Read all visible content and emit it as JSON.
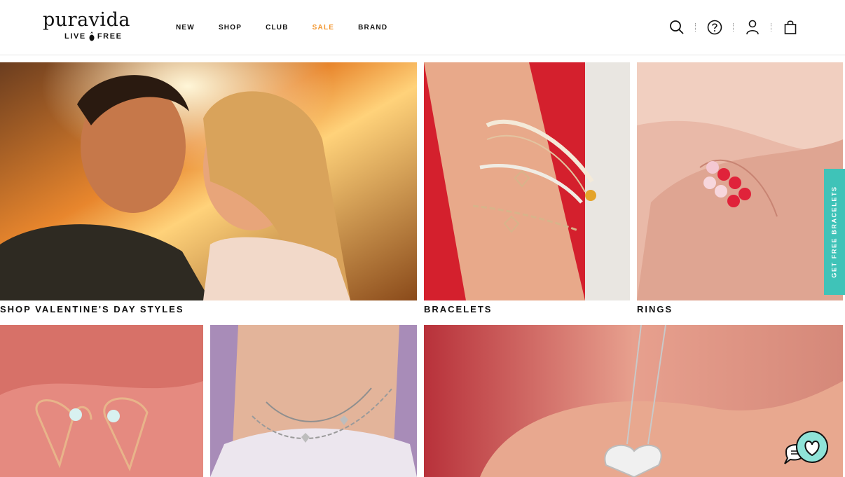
{
  "brand": {
    "name": "puravida",
    "tagline_left": "LIVE",
    "tagline_right": "FREE"
  },
  "nav": [
    {
      "label": "NEW"
    },
    {
      "label": "SHOP"
    },
    {
      "label": "CLUB"
    },
    {
      "label": "SALE",
      "color": "#f2962f"
    },
    {
      "label": "BRAND"
    }
  ],
  "header_icons": [
    "search-icon",
    "help-icon",
    "account-icon",
    "bag-icon"
  ],
  "tiles": [
    {
      "caption": "SHOP VALENTINE'S DAY STYLES"
    },
    {
      "caption": "BRACELETS"
    },
    {
      "caption": "RINGS"
    },
    {
      "caption": ""
    },
    {
      "caption": ""
    },
    {
      "caption": ""
    }
  ],
  "side_tab": {
    "label": "GET FREE BRACELETS",
    "color": "#3fc3b8"
  },
  "chat": {
    "icon": "chat-heart-icon"
  }
}
